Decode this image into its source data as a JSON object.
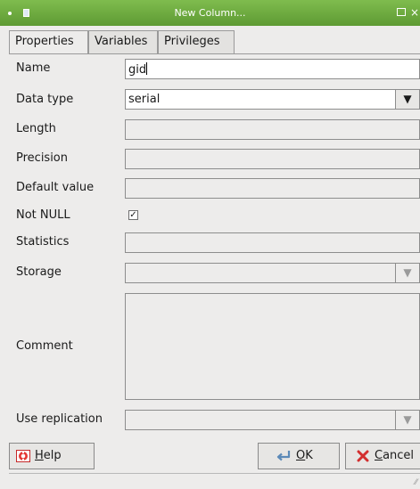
{
  "window": {
    "title": "New Column..."
  },
  "tabs": [
    {
      "label": "Properties"
    },
    {
      "label": "Variables"
    },
    {
      "label": "Privileges"
    }
  ],
  "form": {
    "name": {
      "label": "Name",
      "value": "gid"
    },
    "data_type": {
      "label": "Data type",
      "value": "serial"
    },
    "length": {
      "label": "Length",
      "value": ""
    },
    "precision": {
      "label": "Precision",
      "value": ""
    },
    "default_value": {
      "label": "Default value",
      "value": ""
    },
    "not_null": {
      "label": "Not NULL",
      "checked": true,
      "check_glyph": "✓"
    },
    "statistics": {
      "label": "Statistics",
      "value": ""
    },
    "storage": {
      "label": "Storage",
      "value": ""
    },
    "comment": {
      "label": "Comment",
      "value": ""
    },
    "use_replication": {
      "label": "Use replication",
      "value": ""
    }
  },
  "buttons": {
    "help": {
      "label": "Help",
      "mnemonic": "H",
      "rest": "elp",
      "icon": "lifebuoy-icon"
    },
    "ok": {
      "label": "OK",
      "mnemonic": "O",
      "rest": "K",
      "icon": "return-arrow-icon"
    },
    "cancel": {
      "label": "Cancel",
      "mnemonic": "C",
      "rest": "ancel",
      "icon": "red-x-icon"
    }
  },
  "icons": {
    "dropdown": "▼",
    "close": "×",
    "grip": "⁄⁄"
  },
  "colors": {
    "titlebar": "#6aa83f",
    "panel": "#edeceb",
    "input_white": "#ffffff"
  }
}
